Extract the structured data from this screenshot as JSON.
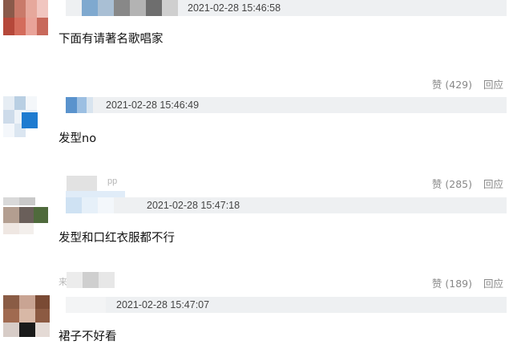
{
  "comments": [
    {
      "timestamp": "2021-02-28 15:46:58",
      "text": "下面有请著名歌唱家"
    },
    {
      "timestamp": "2021-02-28 15:46:49",
      "text": "发型no",
      "prev_like_label": "赞 (429)",
      "prev_reply_label": "回应"
    },
    {
      "name_fragment": "pp",
      "timestamp": "2021-02-28 15:47:18",
      "text": "发型和口红衣服都不行",
      "prev_like_label": "赞 (285)",
      "prev_reply_label": "回应"
    },
    {
      "name_fragment": "来",
      "timestamp": "2021-02-28 15:47:07",
      "text": "裙子不好看",
      "prev_like_label": "赞 (189)",
      "prev_reply_label": "回应"
    }
  ]
}
